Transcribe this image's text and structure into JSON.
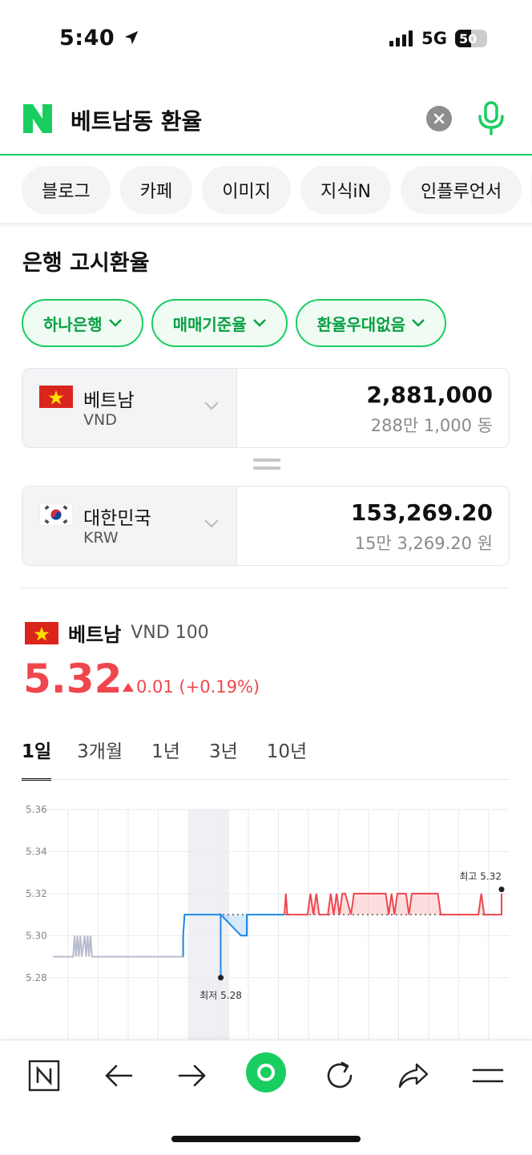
{
  "status": {
    "time": "5:40",
    "network": "5G",
    "battery": "50",
    "battery_level": 0.5
  },
  "search": {
    "query": "베트남동 환율",
    "logo": "N"
  },
  "chips": [
    "블로그",
    "카페",
    "이미지",
    "지식iN",
    "인플루언서"
  ],
  "section_title": "은행 고시환율",
  "filters": [
    "하나은행",
    "매매기준율",
    "환율우대없음"
  ],
  "from": {
    "name": "베트남",
    "code": "VND",
    "amount": "2,881,000",
    "amount_korean": "288만 1,000 동"
  },
  "to": {
    "name": "대한민국",
    "code": "KRW",
    "amount": "153,269.20",
    "amount_korean": "15만 3,269.20 원"
  },
  "rate": {
    "country": "베트남",
    "unit": "VND 100",
    "value": "5.32",
    "change": "0.01 (+0.19%)"
  },
  "tabs": [
    "1일",
    "3개월",
    "1년",
    "3년",
    "10년"
  ],
  "chart_data": {
    "type": "line",
    "y_ticks": [
      "5.36",
      "5.34",
      "5.32",
      "5.30",
      "5.28"
    ],
    "ylim": [
      5.27,
      5.36
    ],
    "reference": 5.31,
    "high_label": "최고 5.32",
    "low_label": "최저 5.28",
    "points": [
      [
        0,
        5.29
      ],
      [
        7,
        5.29
      ],
      [
        7.5,
        5.3
      ],
      [
        8,
        5.29
      ],
      [
        8.5,
        5.3
      ],
      [
        9,
        5.29
      ],
      [
        9.5,
        5.3
      ],
      [
        10,
        5.29
      ],
      [
        11,
        5.3
      ],
      [
        11.5,
        5.29
      ],
      [
        12,
        5.3
      ],
      [
        12.5,
        5.29
      ],
      [
        13,
        5.3
      ],
      [
        13.5,
        5.29
      ],
      [
        14,
        5.29
      ],
      [
        45,
        5.29
      ],
      [
        45,
        5.3
      ],
      [
        45.5,
        5.31
      ],
      [
        58,
        5.31
      ],
      [
        58,
        5.28
      ],
      [
        58,
        5.31
      ],
      [
        65,
        5.3
      ],
      [
        67,
        5.3
      ],
      [
        67,
        5.31
      ],
      [
        80,
        5.31
      ],
      [
        80.5,
        5.32
      ],
      [
        81,
        5.31
      ],
      [
        88,
        5.31
      ],
      [
        89,
        5.32
      ],
      [
        90,
        5.31
      ],
      [
        91,
        5.32
      ],
      [
        92,
        5.31
      ],
      [
        95,
        5.31
      ],
      [
        96,
        5.32
      ],
      [
        97,
        5.31
      ],
      [
        98,
        5.32
      ],
      [
        99,
        5.31
      ],
      [
        100,
        5.32
      ],
      [
        101,
        5.32
      ],
      [
        103,
        5.31
      ],
      [
        104,
        5.32
      ],
      [
        105,
        5.32
      ],
      [
        115,
        5.32
      ],
      [
        116,
        5.31
      ],
      [
        117,
        5.32
      ],
      [
        118,
        5.31
      ],
      [
        119,
        5.32
      ],
      [
        122,
        5.32
      ],
      [
        123,
        5.31
      ],
      [
        124,
        5.32
      ],
      [
        125,
        5.32
      ],
      [
        133,
        5.32
      ],
      [
        134,
        5.31
      ],
      [
        147,
        5.31
      ],
      [
        148,
        5.32
      ],
      [
        149,
        5.31
      ],
      [
        155,
        5.31
      ],
      [
        155,
        5.32
      ]
    ]
  },
  "colors": {
    "accent": "#19ce60",
    "up": "#f0464e",
    "down": "#1e88e5",
    "flat": "#b8bccd"
  },
  "nav_icons": [
    "naver-home-icon",
    "back-arrow-icon",
    "forward-arrow-icon",
    "green-dot-icon",
    "refresh-icon",
    "share-icon",
    "menu-icon"
  ]
}
